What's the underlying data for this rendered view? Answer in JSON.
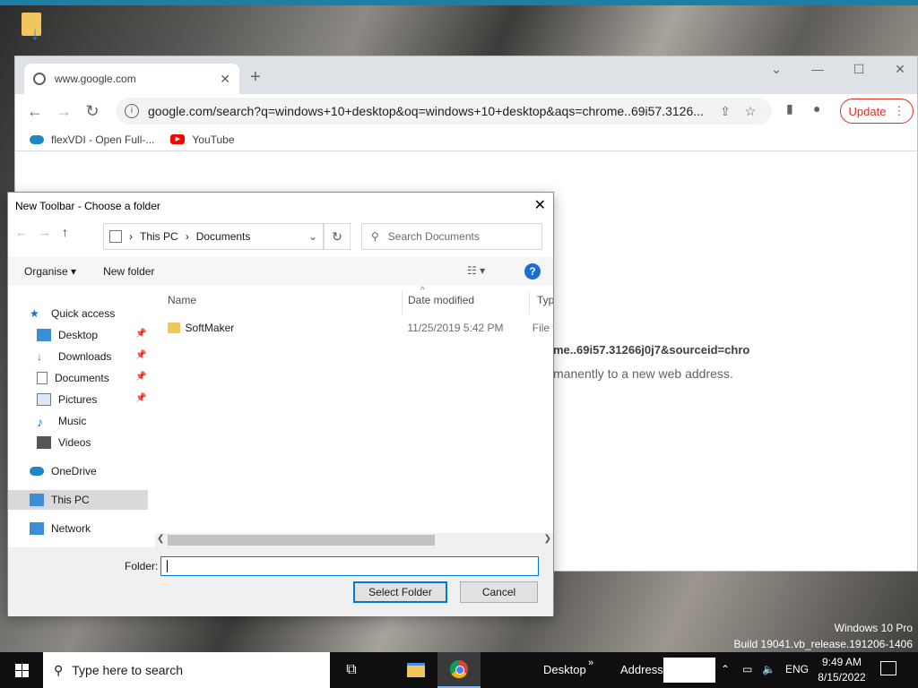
{
  "chrome": {
    "tab_title": "www.google.com",
    "url": "google.com/search?q=windows+10+desktop&oq=windows+10+desktop&aqs=chrome..69i57.3126...",
    "update_label": "Update",
    "bookmarks": [
      {
        "label": "flexVDI - Open Full-...",
        "icon": "flexvdi-cloud-icon"
      },
      {
        "label": "YouTube",
        "icon": "youtube-icon"
      }
    ],
    "content_line1": "me..69i57.31266j0j7&sourceid=chro",
    "content_line2": "manently to a new web address."
  },
  "dialog": {
    "title": "New Toolbar - Choose a folder",
    "breadcrumb": [
      "This PC",
      "Documents"
    ],
    "search_placeholder": "Search Documents",
    "organise_label": "Organise ▾",
    "new_folder_label": "New folder",
    "nav_items": [
      {
        "label": "Quick access",
        "icon": "star-icon",
        "pinned": false
      },
      {
        "label": "Desktop",
        "icon": "desktop-icon",
        "pinned": true
      },
      {
        "label": "Downloads",
        "icon": "download-icon",
        "pinned": true
      },
      {
        "label": "Documents",
        "icon": "documents-icon",
        "pinned": true
      },
      {
        "label": "Pictures",
        "icon": "pictures-icon",
        "pinned": true
      },
      {
        "label": "Music",
        "icon": "music-icon",
        "pinned": false
      },
      {
        "label": "Videos",
        "icon": "videos-icon",
        "pinned": false
      },
      {
        "label": "OneDrive",
        "icon": "onedrive-icon",
        "pinned": false
      },
      {
        "label": "This PC",
        "icon": "this-pc-icon",
        "pinned": false,
        "selected": true
      },
      {
        "label": "Network",
        "icon": "network-icon",
        "pinned": false
      }
    ],
    "columns": [
      "Name",
      "Date modified",
      "Type"
    ],
    "files": [
      {
        "name": "SoftMaker",
        "date": "11/25/2019 5:42 PM",
        "type": "File fo"
      }
    ],
    "folder_label": "Folder:",
    "folder_value": "",
    "select_button": "Select Folder",
    "cancel_button": "Cancel"
  },
  "watermark": {
    "line1": "Windows 10 Pro",
    "line2": "Build 19041.vb_release.191206-1406"
  },
  "taskbar": {
    "search_placeholder": "Type here to search",
    "desktop_label": "Desktop",
    "address_label": "Address",
    "language": "ENG",
    "time": "9:49 AM",
    "date": "8/15/2022"
  }
}
